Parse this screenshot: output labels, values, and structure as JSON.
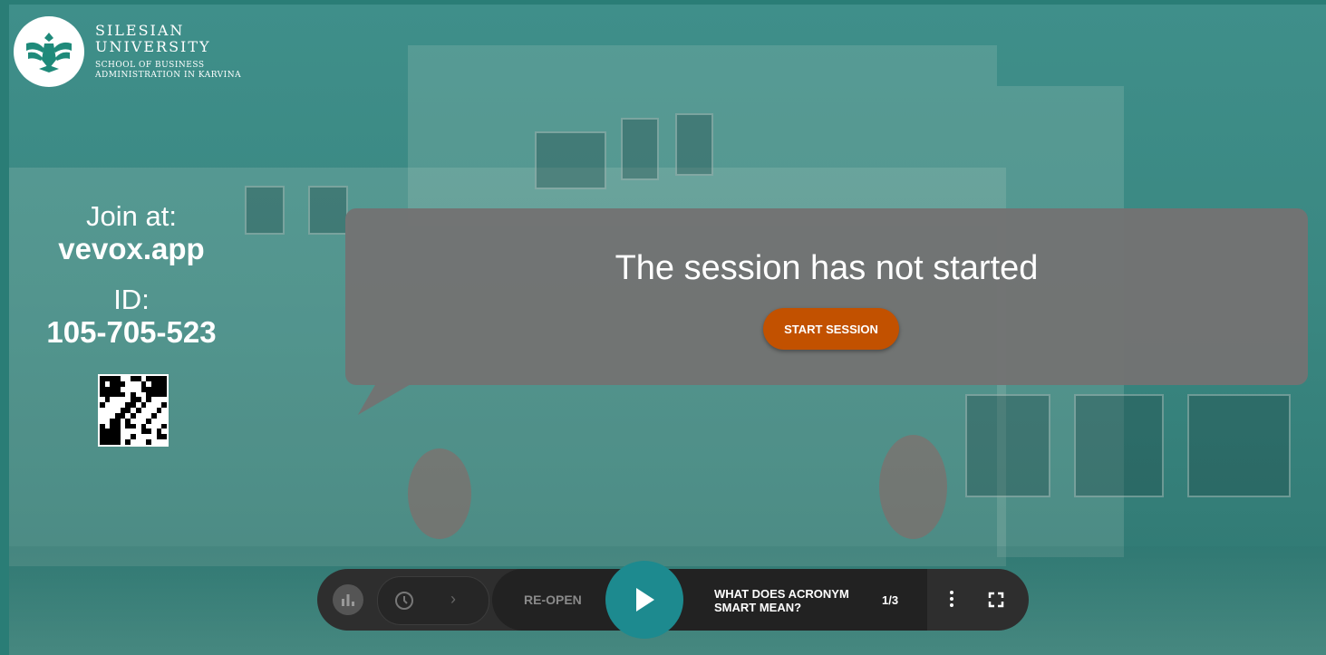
{
  "branding": {
    "name_line1": "SILESIAN",
    "name_line2": "UNIVERSITY",
    "sub_line1": "SCHOOL OF BUSINESS",
    "sub_line2": "ADMINISTRATION IN KARVINA",
    "logo_icon": "eagle-emblem-icon",
    "logo_color": "#1f8a7a"
  },
  "join": {
    "join_label": "Join at:",
    "url": "vevox.app",
    "id_label": "ID:",
    "session_id": "105-705-523",
    "qr_icon": "qr-code-icon"
  },
  "session": {
    "message": "The session has not started",
    "start_label": "START SESSION"
  },
  "controls": {
    "reopen_label": "RE-OPEN",
    "question_line1": "WHAT DOES ACRONYM",
    "question_line2": "SMART MEAN?",
    "counter": "1/3"
  },
  "colors": {
    "accent_orange": "#c25100",
    "play_teal": "#1d8a8f",
    "bar_dark": "#2e2e2e"
  }
}
